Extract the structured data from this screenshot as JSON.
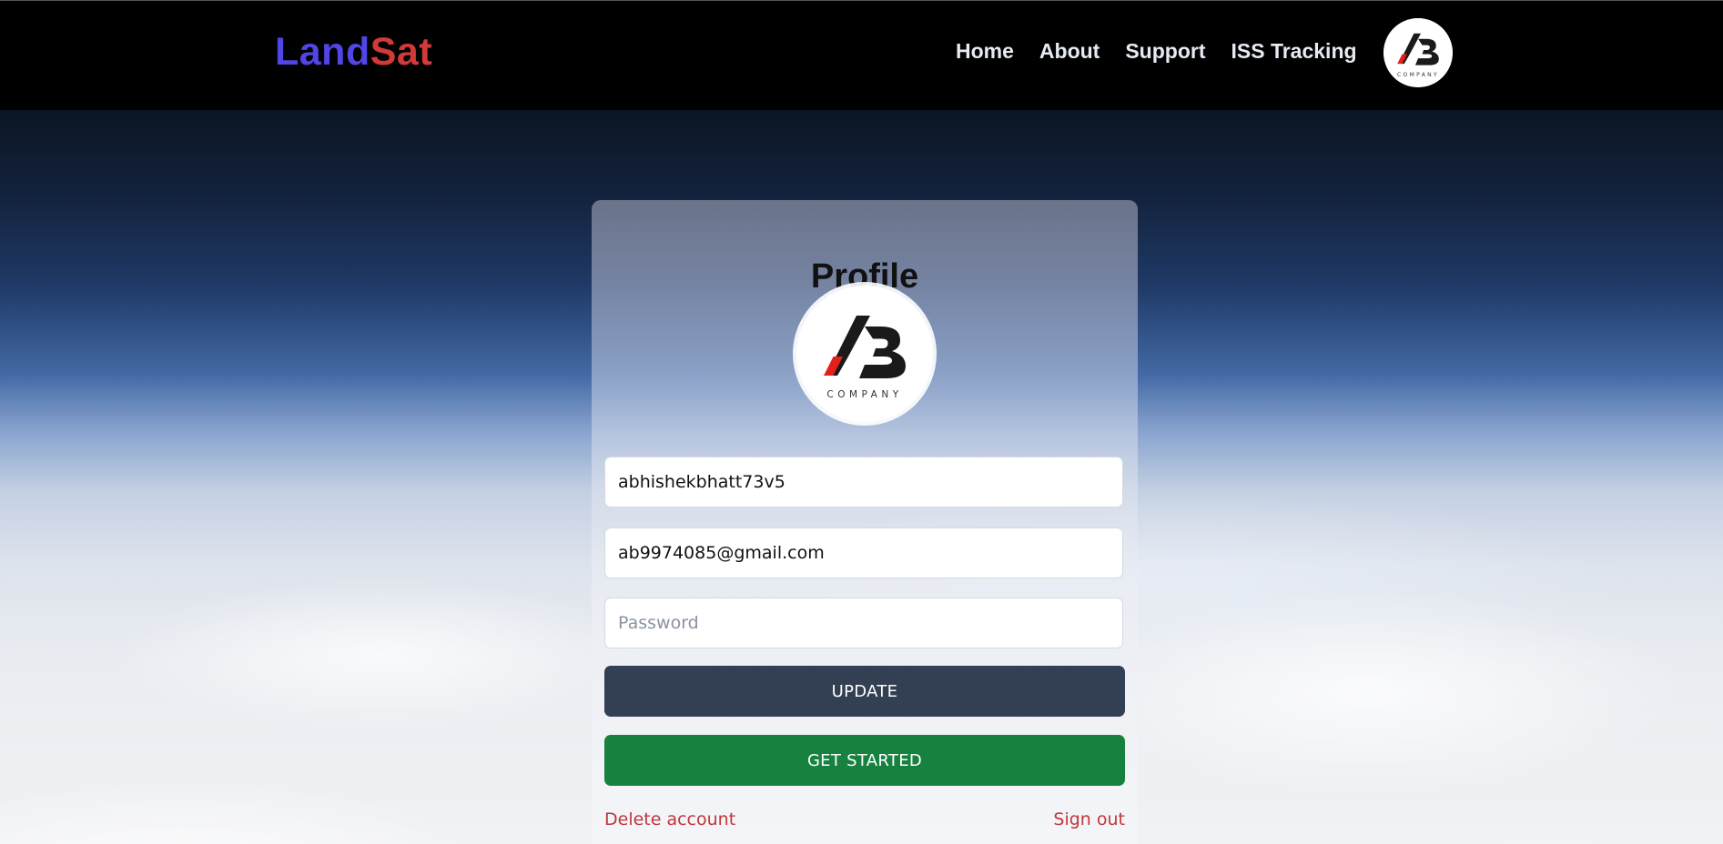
{
  "header": {
    "brand_part1": "Land",
    "brand_part2": "Sat",
    "nav": [
      "Home",
      "About",
      "Support",
      "ISS Tracking"
    ]
  },
  "logo": {
    "letters": "AB",
    "subtext": "COMPANY"
  },
  "profile": {
    "title": "Profile",
    "username": "abhishekbhatt73v5",
    "email": "ab9974085@gmail.com",
    "password_placeholder": "Password",
    "update_label": "UPDATE",
    "get_started_label": "GET STARTED",
    "delete_label": "Delete account",
    "signout_label": "Sign out"
  },
  "colors": {
    "brand_primary": "#4f46e5",
    "brand_secondary": "#d23a3a",
    "update_button": "#333f52",
    "get_started_button": "#178240",
    "danger_link": "#c0363b"
  }
}
